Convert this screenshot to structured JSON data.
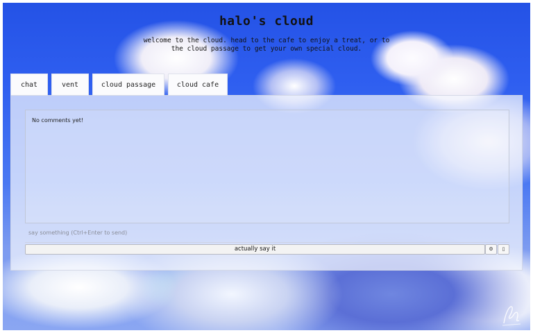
{
  "header": {
    "title": "halo's cloud",
    "subtitle": "welcome to the cloud. head to the cafe to enjoy a treat, or to the cloud passage to get your own special cloud."
  },
  "tabs": [
    {
      "label": "chat"
    },
    {
      "label": "vent"
    },
    {
      "label": "cloud passage"
    },
    {
      "label": "cloud cafe"
    }
  ],
  "comments": {
    "empty_text": "No comments yet!"
  },
  "compose": {
    "placeholder": "say something (Ctrl+Enter to send)",
    "value": ""
  },
  "send_button": {
    "label": "actually say it"
  },
  "icons": {
    "settings": "gear-icon",
    "extra": "square-icon"
  }
}
